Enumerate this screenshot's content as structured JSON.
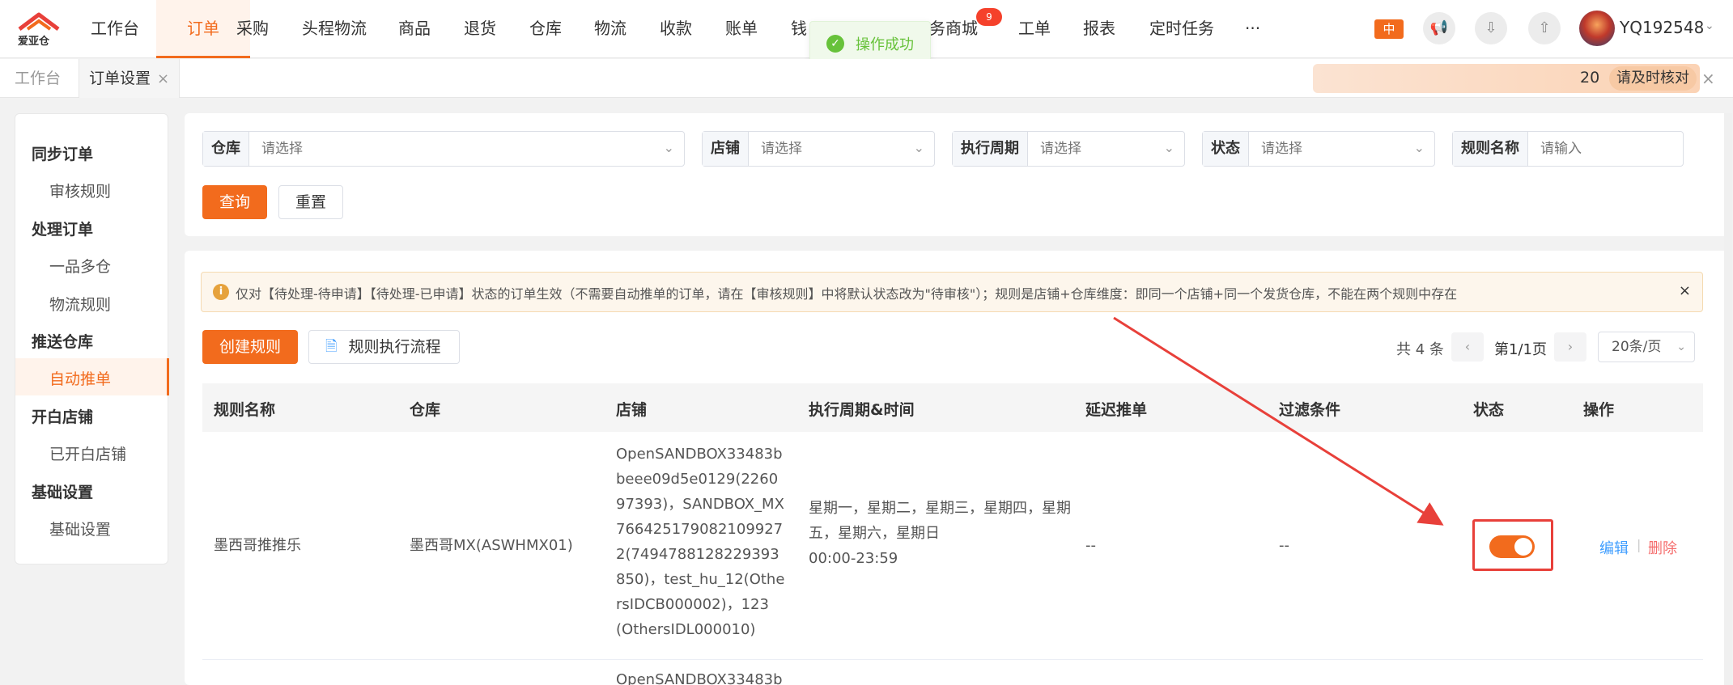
{
  "brand": {
    "logo_text": "爱亚仓"
  },
  "topnav": {
    "items": [
      {
        "label": "工作台"
      },
      {
        "label": "订单"
      },
      {
        "label": "采购"
      },
      {
        "label": "头程物流"
      },
      {
        "label": "商品"
      },
      {
        "label": "退货"
      },
      {
        "label": "仓库"
      },
      {
        "label": "物流"
      },
      {
        "label": "收款"
      },
      {
        "label": "账单"
      },
      {
        "label": "钱"
      },
      {
        "label": "务商城"
      },
      {
        "label": "工单"
      },
      {
        "label": "报表"
      },
      {
        "label": "定时任务"
      },
      {
        "label": "···"
      }
    ],
    "active_index": 1,
    "badge": "9",
    "lang_label": "中",
    "username": "YQ192548"
  },
  "toast": {
    "text": "操作成功"
  },
  "tabs": [
    {
      "label": "工作台",
      "active": false
    },
    {
      "label": "订单设置",
      "active": true
    }
  ],
  "notice": {
    "count": "20",
    "button_label": "请及时核对"
  },
  "sidebar": {
    "groups": [
      {
        "label": "同步订单",
        "items": [
          "审核规则"
        ]
      },
      {
        "label": "处理订单",
        "items": [
          "一品多仓",
          "物流规则"
        ]
      },
      {
        "label": "推送仓库",
        "items": [
          "自动推单"
        ]
      },
      {
        "label": "开白店铺",
        "items": [
          "已开白店铺"
        ]
      },
      {
        "label": "基础设置",
        "items": [
          "基础设置"
        ]
      }
    ],
    "active_item": "自动推单"
  },
  "filters": [
    {
      "label": "仓库",
      "placeholder": "请选择",
      "type": "select"
    },
    {
      "label": "店铺",
      "placeholder": "请选择",
      "type": "select"
    },
    {
      "label": "执行周期",
      "placeholder": "请选择",
      "type": "select"
    },
    {
      "label": "状态",
      "placeholder": "请选择",
      "type": "select"
    },
    {
      "label": "规则名称",
      "placeholder": "请输入",
      "type": "input"
    }
  ],
  "filter_buttons": {
    "query": "查询",
    "reset": "重置"
  },
  "alert": {
    "text": "仅对【待处理-待申请】【待处理-已申请】状态的订单生效（不需要自动推单的订单，请在【审核规则】中将默认状态改为\"待审核\"）；规则是店铺+仓库维度：即同一个店铺+同一个发货仓库，不能在两个规则中存在"
  },
  "actions": {
    "create": "创建规则",
    "flow": "规则执行流程"
  },
  "pager": {
    "total": "共 4 条",
    "page": "第1/1页",
    "page_size": "20条/页"
  },
  "table": {
    "columns": [
      "规则名称",
      "仓库",
      "店铺",
      "执行周期&时间",
      "延迟推单",
      "过滤条件",
      "状态",
      "操作"
    ],
    "rows": [
      {
        "name": "墨西哥推推乐",
        "warehouse": "墨西哥MX(ASWHMX01)",
        "shops": "OpenSANDBOX33483bbeee09d5e0129(226097393)，SANDBOX_MX7664251790821099272(7494788128229393850)，test_hu_12(OthersIDCB000002)，123(OthersIDL000010)",
        "schedule_days": "星期一，星期二，星期三，星期四，星期五，星期六，星期日",
        "schedule_time": "00:00-23:59",
        "delay": "--",
        "filter": "--",
        "status_on": true,
        "op_edit": "编辑",
        "op_delete": "删除"
      },
      {
        "shops": "OpenSANDBOX33483b"
      }
    ]
  },
  "colors": {
    "accent": "#f26b1d",
    "annotation": "#e8403a",
    "link": "#409eff",
    "danger": "#f56c6c",
    "success": "#67c23a"
  }
}
